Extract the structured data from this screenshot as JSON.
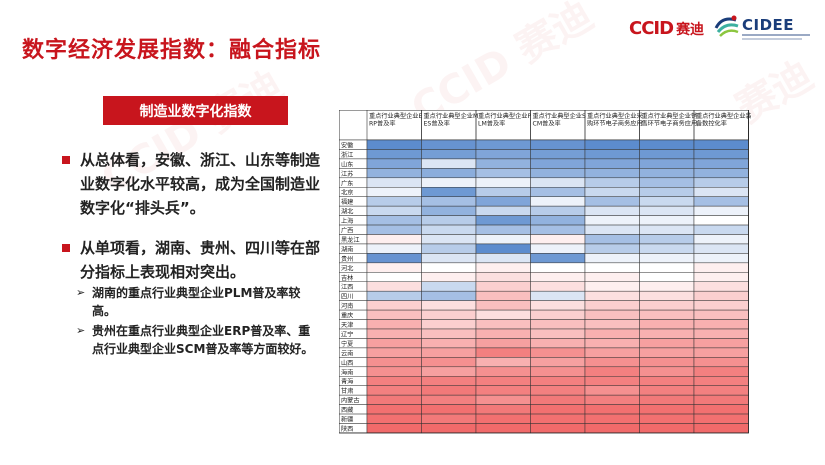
{
  "title": "数字经济发展指数：融合指标",
  "logos": {
    "ccid": "CCID",
    "ccid_cn": "赛迪",
    "cidee": "CIDEE"
  },
  "watermark": "CCID 赛迪",
  "section_tag": "制造业数字化指数",
  "bullets": [
    {
      "text": "从总体看，安徽、浙江、山东等制造业数字化水平较高，成为全国制造业数字化“排头兵”。"
    },
    {
      "text": "从单项看，湖南、贵州、四川等在部分指标上表现相对突出。"
    }
  ],
  "sub_bullets": [
    {
      "arrow": "➢",
      "text": "湖南的重点行业典型企业PLM普及率较高。"
    },
    {
      "arrow": "➢",
      "text": "贵州在重点行业典型企业ERP普及率、重点行业典型企业SCM普及率等方面较好。"
    }
  ],
  "colors": {
    "accent": "#c8151d",
    "high": "#4a7fc8",
    "mid": "#ffffff",
    "low": "#f06060"
  },
  "chart_data": {
    "type": "heatmap",
    "columns": [
      "重点行业典型企业ERP普及率",
      "重点行业典型企业MES普及率",
      "重点行业典型企业PLM普及率",
      "重点行业典型企业SCM普及率",
      "重点行业典型企业采购环节电子商务应用",
      "重点行业典型企业销售环节电子商务应用",
      "重点行业典型企业装备数控化率"
    ],
    "rows": [
      "安徽",
      "浙江",
      "山东",
      "江苏",
      "广东",
      "北京",
      "福建",
      "湖北",
      "上海",
      "广西",
      "黑龙江",
      "湖南",
      "贵州",
      "河北",
      "吉林",
      "江西",
      "四川",
      "河南",
      "重庆",
      "天津",
      "辽宁",
      "宁夏",
      "云南",
      "山西",
      "海南",
      "青海",
      "甘肃",
      "内蒙古",
      "西藏",
      "新疆",
      "陕西"
    ],
    "values": [
      [
        0.95,
        0.92,
        0.9,
        0.92,
        0.95,
        0.95,
        0.95
      ],
      [
        0.9,
        0.88,
        0.85,
        0.88,
        0.9,
        0.9,
        0.9
      ],
      [
        0.85,
        0.6,
        0.8,
        0.85,
        0.85,
        0.85,
        0.85
      ],
      [
        0.8,
        0.82,
        0.75,
        0.8,
        0.8,
        0.8,
        0.8
      ],
      [
        0.6,
        0.55,
        0.55,
        0.6,
        0.7,
        0.75,
        0.7
      ],
      [
        0.55,
        0.9,
        0.7,
        0.75,
        0.65,
        0.7,
        0.6
      ],
      [
        0.7,
        0.75,
        0.85,
        0.55,
        0.75,
        0.65,
        0.75
      ],
      [
        0.65,
        0.8,
        0.65,
        0.7,
        0.6,
        0.6,
        0.55
      ],
      [
        0.75,
        0.7,
        0.9,
        0.8,
        0.55,
        0.55,
        0.5
      ],
      [
        0.75,
        0.65,
        0.75,
        0.75,
        0.6,
        0.6,
        0.65
      ],
      [
        0.45,
        0.6,
        0.55,
        0.45,
        0.75,
        0.7,
        0.55
      ],
      [
        0.55,
        0.7,
        0.95,
        0.55,
        0.7,
        0.65,
        0.6
      ],
      [
        0.92,
        0.6,
        0.6,
        0.9,
        0.55,
        0.55,
        0.55
      ],
      [
        0.45,
        0.5,
        0.45,
        0.5,
        0.5,
        0.5,
        0.45
      ],
      [
        0.5,
        0.45,
        0.4,
        0.45,
        0.45,
        0.5,
        0.45
      ],
      [
        0.4,
        0.65,
        0.35,
        0.4,
        0.45,
        0.45,
        0.4
      ],
      [
        0.7,
        0.75,
        0.3,
        0.6,
        0.4,
        0.4,
        0.35
      ],
      [
        0.35,
        0.4,
        0.3,
        0.4,
        0.35,
        0.35,
        0.35
      ],
      [
        0.3,
        0.35,
        0.4,
        0.35,
        0.3,
        0.3,
        0.3
      ],
      [
        0.25,
        0.35,
        0.3,
        0.3,
        0.3,
        0.25,
        0.25
      ],
      [
        0.25,
        0.3,
        0.25,
        0.3,
        0.25,
        0.25,
        0.25
      ],
      [
        0.2,
        0.25,
        0.2,
        0.25,
        0.25,
        0.2,
        0.2
      ],
      [
        0.2,
        0.2,
        0.1,
        0.15,
        0.2,
        0.2,
        0.2
      ],
      [
        0.15,
        0.15,
        0.25,
        0.2,
        0.15,
        0.15,
        0.15
      ],
      [
        0.15,
        0.2,
        0.15,
        0.15,
        0.1,
        0.15,
        0.1
      ],
      [
        0.1,
        0.1,
        0.1,
        0.1,
        0.1,
        0.1,
        0.1
      ],
      [
        0.1,
        0.08,
        0.1,
        0.1,
        0.15,
        0.1,
        0.1
      ],
      [
        0.08,
        0.1,
        0.15,
        0.08,
        0.1,
        0.08,
        0.08
      ],
      [
        0.05,
        0.05,
        0.08,
        0.05,
        0.05,
        0.05,
        0.05
      ],
      [
        0.05,
        0.08,
        0.05,
        0.05,
        0.05,
        0.05,
        0.05
      ],
      [
        0.03,
        0.03,
        0.03,
        0.03,
        0.03,
        0.03,
        0.03
      ]
    ],
    "legend": "none",
    "grid": true
  }
}
